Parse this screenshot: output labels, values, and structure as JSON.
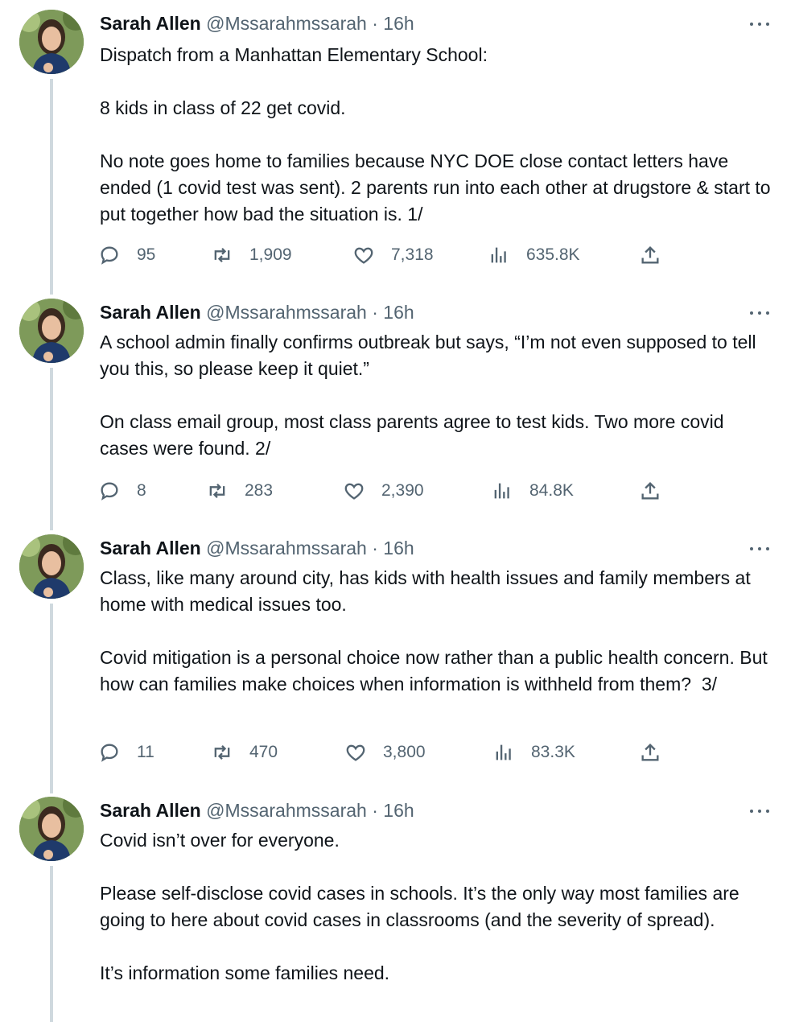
{
  "author": {
    "name": "Sarah Allen",
    "handle": "@Mssarahmssarah",
    "separator": "·",
    "time": "16h"
  },
  "icons": {
    "reply": "reply-icon",
    "retweet": "retweet-icon",
    "like": "heart-icon",
    "views": "views-icon",
    "share": "share-icon",
    "more": "more-icon"
  },
  "colors": {
    "muted": "#536471",
    "text": "#0f1419",
    "thread_line": "#cfd9de"
  },
  "tweets": [
    {
      "paragraphs": [
        "Dispatch from a Manhattan Elementary School:",
        "8 kids in class of 22 get covid.",
        "No note goes home to families because NYC DOE close contact letters have ended (1 covid test was sent). 2 parents run into each other at drugstore & start to put together how bad the situation is. 1/"
      ],
      "replies": "95",
      "retweets": "1,909",
      "likes": "7,318",
      "views": "635.8K"
    },
    {
      "paragraphs": [
        "A school admin finally confirms outbreak but says, “I’m not even supposed to tell you this, so please keep it quiet.”",
        "On class email group, most class parents agree to test kids. Two more covid cases were found. 2/"
      ],
      "replies": "8",
      "retweets": "283",
      "likes": "2,390",
      "views": "84.8K"
    },
    {
      "paragraphs": [
        "Class, like many around city, has kids with health issues and family members at home with medical issues too.",
        "Covid mitigation is a personal choice now rather than a public health concern. But how can families make choices when information is withheld from them?  3/"
      ],
      "replies": "11",
      "retweets": "470",
      "likes": "3,800",
      "views": "83.3K"
    },
    {
      "paragraphs": [
        "Covid isn’t over for everyone.",
        "Please self-disclose covid cases in schools. It’s the only way most families are going to here about covid cases in classrooms (and the severity of spread).",
        "It’s information some families need."
      ]
    }
  ]
}
